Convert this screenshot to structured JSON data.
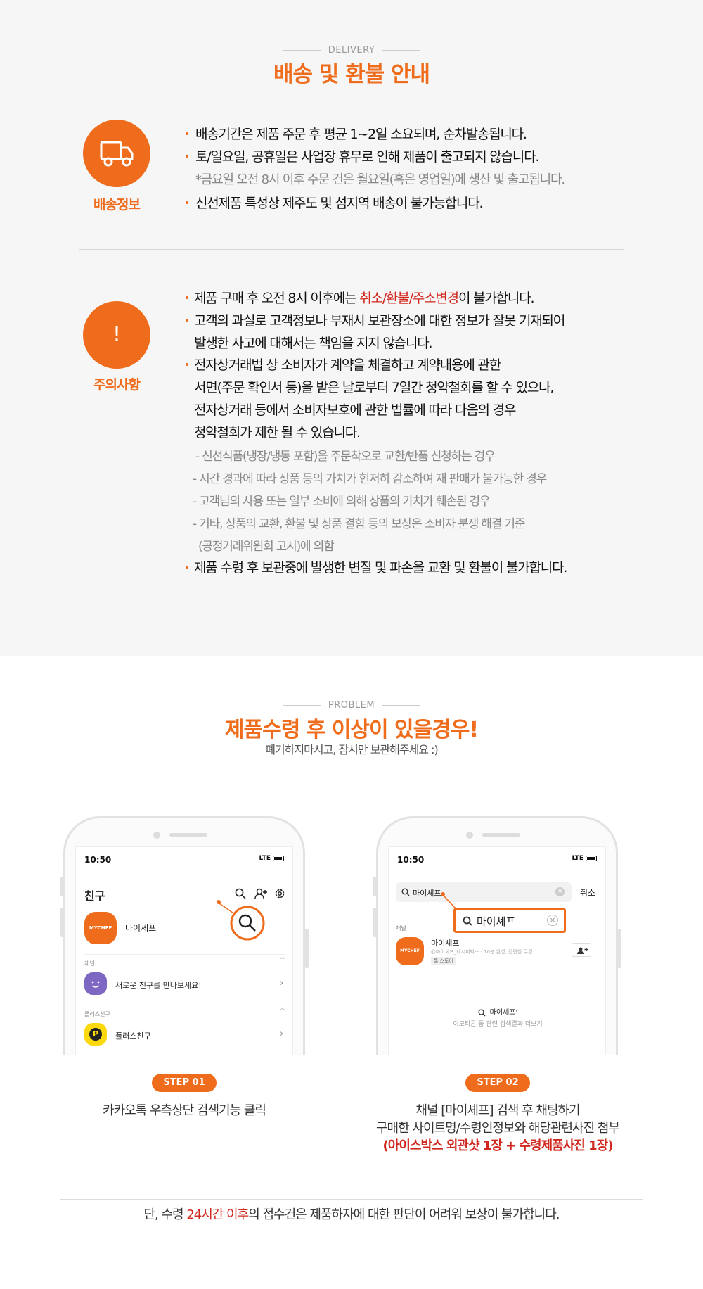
{
  "delivery": {
    "eyebrow": "DELIVERY",
    "title": "배송 및 환불 안내",
    "info_label": "배송정보",
    "info_lines": [
      "배송기간은 제품 주문 후 평균 1~2일 소요되며, 순차발송됩니다.",
      "토/일요일, 공휴일은 사업장 휴무로 인해 제품이 출고되지 않습니다.",
      "*금요일 오전 8시 이후 주문 건은 월요일(혹은 영업일)에 생산 및 출고됩니다.",
      "신선제품 특성상 제주도 및 섬지역 배송이 불가능합니다."
    ],
    "caution_label": "주의사항",
    "caution_icon": "!",
    "caution": {
      "l1_pre": "제품 구매 후 오전 8시 이후에는 ",
      "l1_red": "취소/환불/주소변경",
      "l1_post": "이 불가합니다.",
      "l2": "고객의 과실로 고객정보나 부재시 보관장소에 대한 정보가 잘못 기재되어",
      "l3": "발생한 사고에 대해서는 책임을 지지 않습니다.",
      "l4": "전자상거래법 상 소비자가 계약을 체결하고 계약내용에 관한",
      "l5": "서면(주문 확인서 등)을 받은 날로부터 7일간 청약철회를 할 수 있으나,",
      "l6": "전자상거래 등에서 소비자보호에 관한 법률에 따라 다음의 경우",
      "l7": "청약철회가 제한 될 수 있습니다.",
      "s1": "- 신선식품(냉장/냉동 포함)을 주문착오로 교환/반품 신청하는 경우",
      "s2": "- 시간 경과에 따라 상품 등의 가치가 현저히 감소하여 재 판매가 불가능한 경우",
      "s3": "- 고객님의 사용 또는 일부 소비에 의해 상품의 가치가 훼손된 경우",
      "s4": "- 기타, 상품의 교환, 환불 및 상품 결함 등의 보상은 소비자 분쟁 해결 기준",
      "s5": "(공정거래위원회 고시)에 의함",
      "l8": "제품 수령 후 보관중에 발생한 변질 및 파손을 교환 및 환불이 불가합니다."
    }
  },
  "problem": {
    "eyebrow": "PROBLEM",
    "title": "제품수령 후 이상이 있을경우!",
    "subtitle": "폐기하지마시고, 잠시만 보관해주세요 :)",
    "phone1": {
      "time": "10:50",
      "carrier": "LTE",
      "header": "친구",
      "profile_logo": "MYCHEF",
      "profile_name": "마이셰프",
      "section_channel": "채널",
      "channel_item": "새로운 친구를 만나보세요!",
      "section_plus": "플러스친구",
      "plus_item": "플러스친구",
      "plus_badge": "P"
    },
    "phone2": {
      "time": "10:50",
      "carrier": "LTE",
      "search_text": "마이셰프",
      "cancel": "취소",
      "zoom_text": "마이셰프",
      "section_channel": "채널",
      "result_logo": "MYCHEF",
      "result_name": "마이셰프",
      "result_desc": "@마이셰프_레시피박스 · 10분 완성, 간편한 쿠킹...",
      "result_tag": "톡 스토어",
      "more_title": "'마이셰프'",
      "more_desc": "이모티콘 등 관련 검색결과 더보기"
    },
    "step1": {
      "label": "STEP 01",
      "desc": "카카오톡 우측상단 검색기능 클릭"
    },
    "step2": {
      "label": "STEP 02",
      "line1": "채널 [마이셰프] 검색 후 채팅하기",
      "line2": "구매한 사이트명/수령인정보와 해당관련사진 첨부",
      "line3": "(아이스박스 외관샷 1장 + 수령제품사진 1장)"
    },
    "note": {
      "pre": "단, 수령 ",
      "red": "24시간 이후",
      "post": "의 접수건은 제품하자에 대한 판단이 어려워 보상이 불가합니다."
    }
  },
  "colors": {
    "accent": "#ef6c1c",
    "red": "#d0281f",
    "section_bg": "#f6f6f6"
  }
}
